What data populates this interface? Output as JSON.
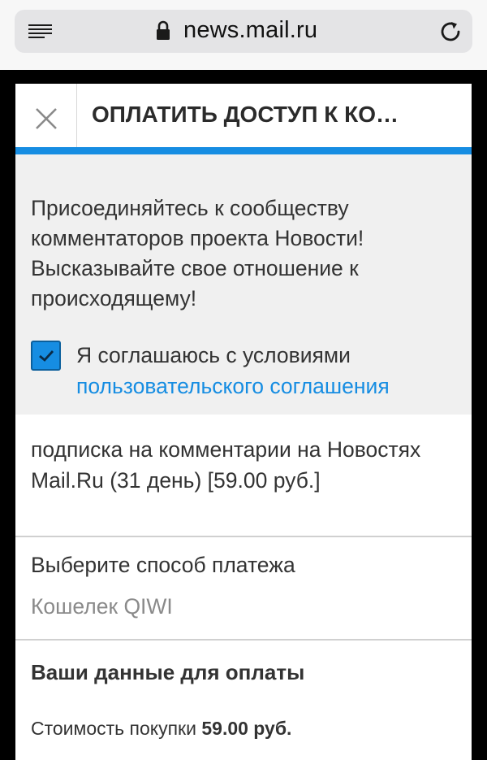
{
  "browser": {
    "url": "news.mail.ru",
    "icons": [
      "menu-icon",
      "lock-icon",
      "reload-icon"
    ]
  },
  "dialog": {
    "title": "ОПЛАТИТЬ ДОСТУП К КО…",
    "close_icon": "close-icon",
    "intro_text": "Присоединяйтесь к сообществу комментаторов проекта Новости! Высказывайте свое отношение к происходящему!",
    "agreement": {
      "checked": true,
      "text": "Я соглашаюсь с условиями",
      "link_text": "пользовательского соглашения"
    },
    "subscription_text": "подписка на комментарии на Новостях Mail.Ru (31 день) [59.00 руб.]",
    "payment": {
      "label": "Выберите способ платежа",
      "selected": "Кошелек QIWI"
    },
    "payment_data": {
      "title": "Ваши данные для оплаты",
      "cost_label": "Стоимость покупки",
      "cost_value": "59.00 руб."
    }
  },
  "colors": {
    "accent": "#168de2",
    "panel_gray": "#f0f0f0"
  }
}
